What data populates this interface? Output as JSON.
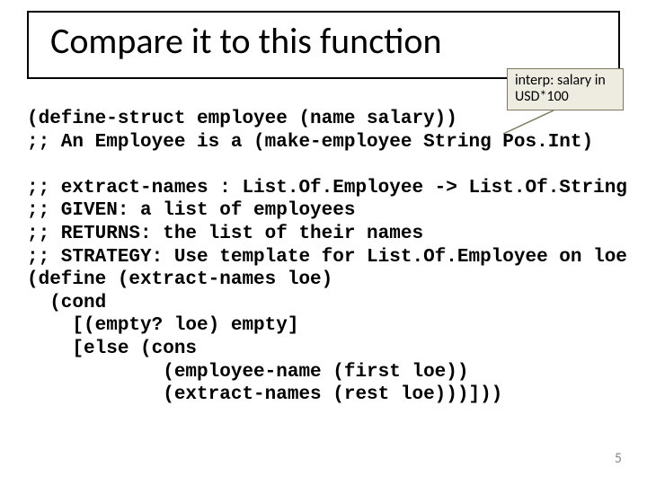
{
  "title": "Compare it to this function",
  "callout": {
    "line1": "interp: salary in",
    "line2": "USD*100"
  },
  "code": {
    "l1": "(define-struct employee (name salary))",
    "l2": ";; An Employee is a (make-employee String Pos.Int)",
    "l3": "",
    "l4": ";; extract-names : List.Of.Employee -> List.Of.String",
    "l5": ";; GIVEN: a list of employees",
    "l6": ";; RETURNS: the list of their names",
    "l7": ";; STRATEGY: Use template for List.Of.Employee on loe",
    "l8": "(define (extract-names loe)",
    "l9": "  (cond",
    "l10": "    [(empty? loe) empty]",
    "l11": "    [else (cons",
    "l12": "            (employee-name (first loe))",
    "l13": "            (extract-names (rest loe)))]))"
  },
  "slideNumber": "5"
}
